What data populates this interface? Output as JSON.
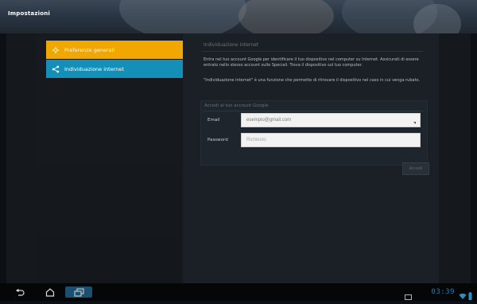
{
  "header": {
    "title": "Impostazioni"
  },
  "sidebar": {
    "items": [
      {
        "label": "Preferenze generali",
        "selected": true,
        "icon": "settings-icon",
        "color": "#f0a800"
      },
      {
        "label": "Individuazione internet",
        "selected": false,
        "icon": "share-icon",
        "color": "#1490b8"
      }
    ]
  },
  "main": {
    "title": "Individuazione internet",
    "paragraph1": "Entra nel tuo account Google per identificare il tuo dispositivo nel computer su Internet. Assicurati di essere entrato nello stesso account sulle Speciali. Trova il dispositivo sul tuo computer.",
    "paragraph2": "\"Individuazione internet\" è una funzione che permette di ritrovare il dispositivo nel caso in cui venga rubato.",
    "login": {
      "heading": "Accedi al tuo account Google",
      "email_label": "Email",
      "email_value": "esempio@gmail.com",
      "password_label": "Password",
      "password_placeholder": "Richiesto",
      "button_label": "Accedi"
    }
  },
  "statusbar": {
    "time": "03:39",
    "icons": [
      "screenshot-icon",
      "wifi-icon",
      "battery-icon"
    ]
  },
  "navbar": {
    "buttons": [
      "back-icon",
      "home-icon",
      "recent-apps-icon"
    ]
  },
  "colors": {
    "accent": "#f0a800",
    "secondary": "#1490b8",
    "clock": "#1f7fb2"
  }
}
